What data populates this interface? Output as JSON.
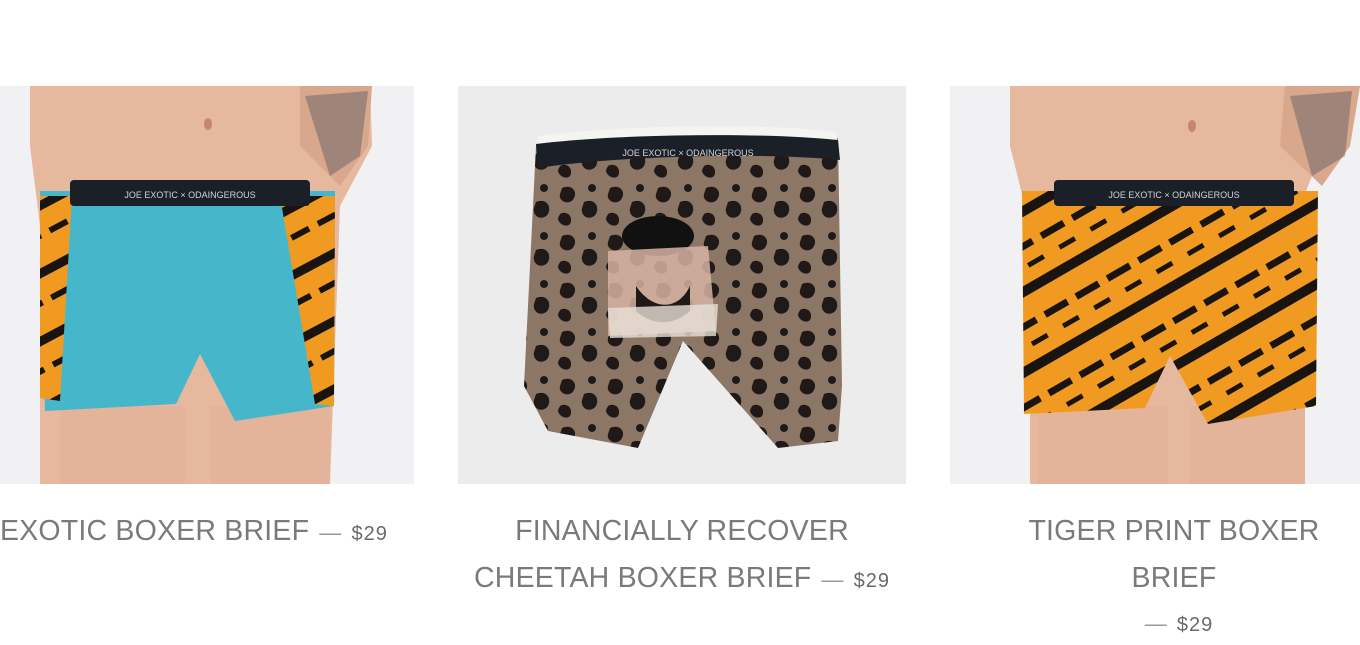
{
  "products": [
    {
      "title": "EXOTIC BOXER BRIEF",
      "price": "$29",
      "waistband": "JOE EXOTIC × ODAINGEROUS"
    },
    {
      "title_line1": "FINANCIALLY RECOVER",
      "title_line2": "CHEETAH BOXER BRIEF",
      "price": "$29",
      "waistband": "JOE EXOTIC × ODAINGEROUS"
    },
    {
      "title": "TIGER PRINT BOXER BRIEF",
      "price": "$29",
      "waistband": "JOE EXOTIC × ODAINGEROUS"
    }
  ],
  "separator": "—",
  "colors": {
    "turquoise": "#46b7cb",
    "tiger_orange": "#f09a22",
    "cheetah_tan": "#8c7766",
    "waistband": "#1b2028",
    "skin": "#e7b89c",
    "caption_gray": "#7a7a7a"
  }
}
